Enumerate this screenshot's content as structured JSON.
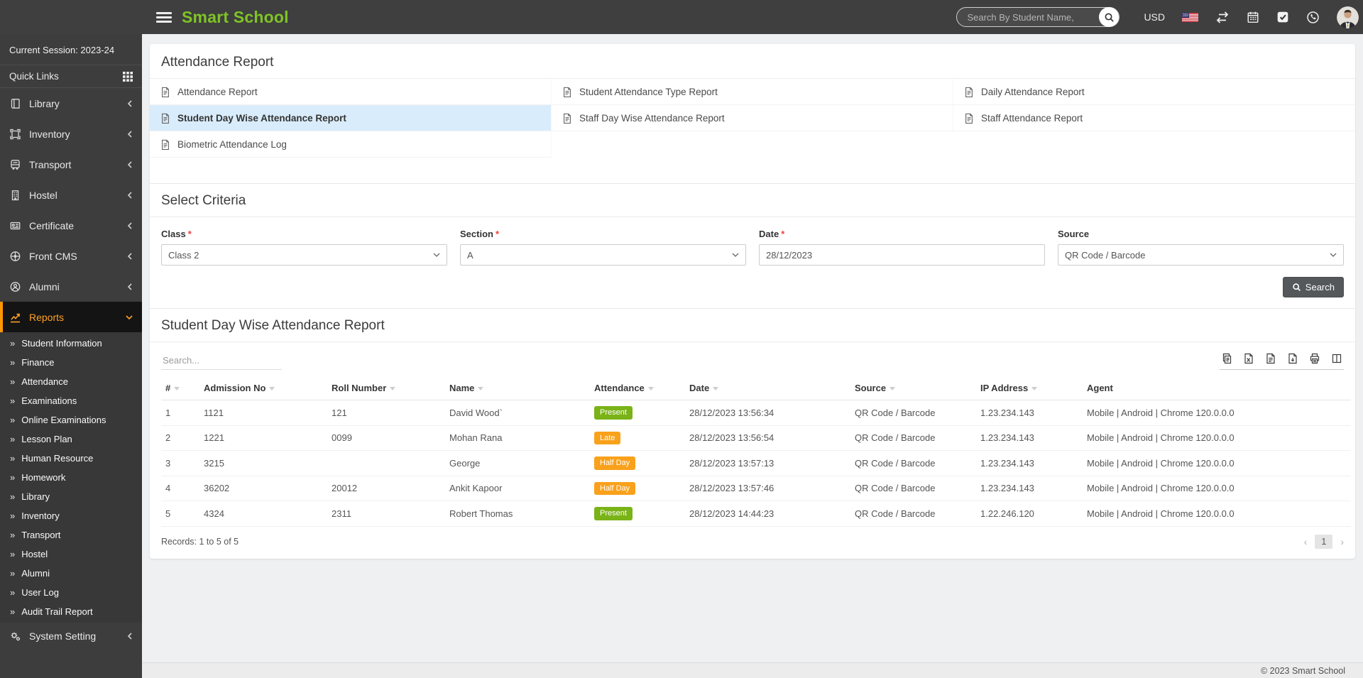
{
  "header": {
    "logo": "Smart School",
    "search_placeholder": "Search By Student Name,",
    "currency": "USD",
    "icons": [
      "hamburger-icon",
      "search-icon",
      "us-flag-icon",
      "compare-arrows-icon",
      "calendar-icon",
      "task-check-icon",
      "whatsapp-icon",
      "user-avatar"
    ]
  },
  "sidebar": {
    "session_label": "Current Session: 2023-24",
    "quick_links_label": "Quick Links",
    "items": [
      {
        "label": "Library"
      },
      {
        "label": "Inventory"
      },
      {
        "label": "Transport"
      },
      {
        "label": "Hostel"
      },
      {
        "label": "Certificate"
      },
      {
        "label": "Front CMS"
      },
      {
        "label": "Alumni"
      },
      {
        "label": "Reports"
      }
    ],
    "reports_submenu": [
      "Student Information",
      "Finance",
      "Attendance",
      "Examinations",
      "Online Examinations",
      "Lesson Plan",
      "Human Resource",
      "Homework",
      "Library",
      "Inventory",
      "Transport",
      "Hostel",
      "Alumni",
      "User Log",
      "Audit Trail Report"
    ],
    "system_setting_label": "System Setting"
  },
  "report_nav": {
    "title": "Attendance Report",
    "links": [
      {
        "label": "Attendance Report"
      },
      {
        "label": "Student Attendance Type Report"
      },
      {
        "label": "Daily Attendance Report"
      },
      {
        "label": "Student Day Wise Attendance Report"
      },
      {
        "label": "Staff Day Wise Attendance Report"
      },
      {
        "label": "Staff Attendance Report"
      },
      {
        "label": "Biometric Attendance Log"
      }
    ]
  },
  "criteria": {
    "title": "Select Criteria",
    "required_marker": "*",
    "fields": [
      {
        "label": "Class",
        "value": "Class 2",
        "type": "select"
      },
      {
        "label": "Section",
        "value": "A",
        "type": "select"
      },
      {
        "label": "Date",
        "value": "28/12/2023",
        "type": "text"
      },
      {
        "label": "Source",
        "value": "QR Code / Barcode",
        "type": "select"
      }
    ],
    "search_button_label": "Search"
  },
  "report_table": {
    "title": "Student Day Wise Attendance Report",
    "search_placeholder": "Search...",
    "export_icons": [
      "copy-icon",
      "excel-icon",
      "csv-icon",
      "pdf-icon",
      "print-icon",
      "columns-icon"
    ],
    "columns": [
      "#",
      "Admission No",
      "Roll Number",
      "Name",
      "Attendance",
      "Date",
      "Source",
      "IP Address",
      "Agent"
    ],
    "badge_colors": {
      "Present": "#7ab317",
      "Late": "#f9a11b",
      "Half Day": "#f9a11b"
    },
    "rows": [
      {
        "num": "1",
        "admission_no": "1121",
        "roll_number": "121",
        "name": "David Wood`",
        "attendance": "Present",
        "date": "28/12/2023 13:56:34",
        "source": "QR Code / Barcode",
        "ip": "1.23.234.143",
        "agent": "Mobile | Android | Chrome 120.0.0.0"
      },
      {
        "num": "2",
        "admission_no": "1221",
        "roll_number": "0099",
        "name": "Mohan Rana",
        "attendance": "Late",
        "date": "28/12/2023 13:56:54",
        "source": "QR Code / Barcode",
        "ip": "1.23.234.143",
        "agent": "Mobile | Android | Chrome 120.0.0.0"
      },
      {
        "num": "3",
        "admission_no": "3215",
        "roll_number": "",
        "name": "George",
        "attendance": "Half Day",
        "date": "28/12/2023 13:57:13",
        "source": "QR Code / Barcode",
        "ip": "1.23.234.143",
        "agent": "Mobile | Android | Chrome 120.0.0.0"
      },
      {
        "num": "4",
        "admission_no": "36202",
        "roll_number": "20012",
        "name": "Ankit Kapoor",
        "attendance": "Half Day",
        "date": "28/12/2023 13:57:46",
        "source": "QR Code / Barcode",
        "ip": "1.23.234.143",
        "agent": "Mobile | Android | Chrome 120.0.0.0"
      },
      {
        "num": "5",
        "admission_no": "4324",
        "roll_number": "2311",
        "name": "Robert Thomas",
        "attendance": "Present",
        "date": "28/12/2023 14:44:23",
        "source": "QR Code / Barcode",
        "ip": "1.22.246.120",
        "agent": "Mobile | Android | Chrome 120.0.0.0"
      }
    ],
    "records_text": "Records: 1 to 5 of 5",
    "pagination": {
      "prev": "‹",
      "page": "1",
      "next": "›"
    }
  },
  "footer": {
    "copyright": "© 2023 Smart School"
  },
  "colors": {
    "brand_green": "#7ec425",
    "active_orange": "#ffa226",
    "selected_link_bg": "#d9ecfb"
  }
}
